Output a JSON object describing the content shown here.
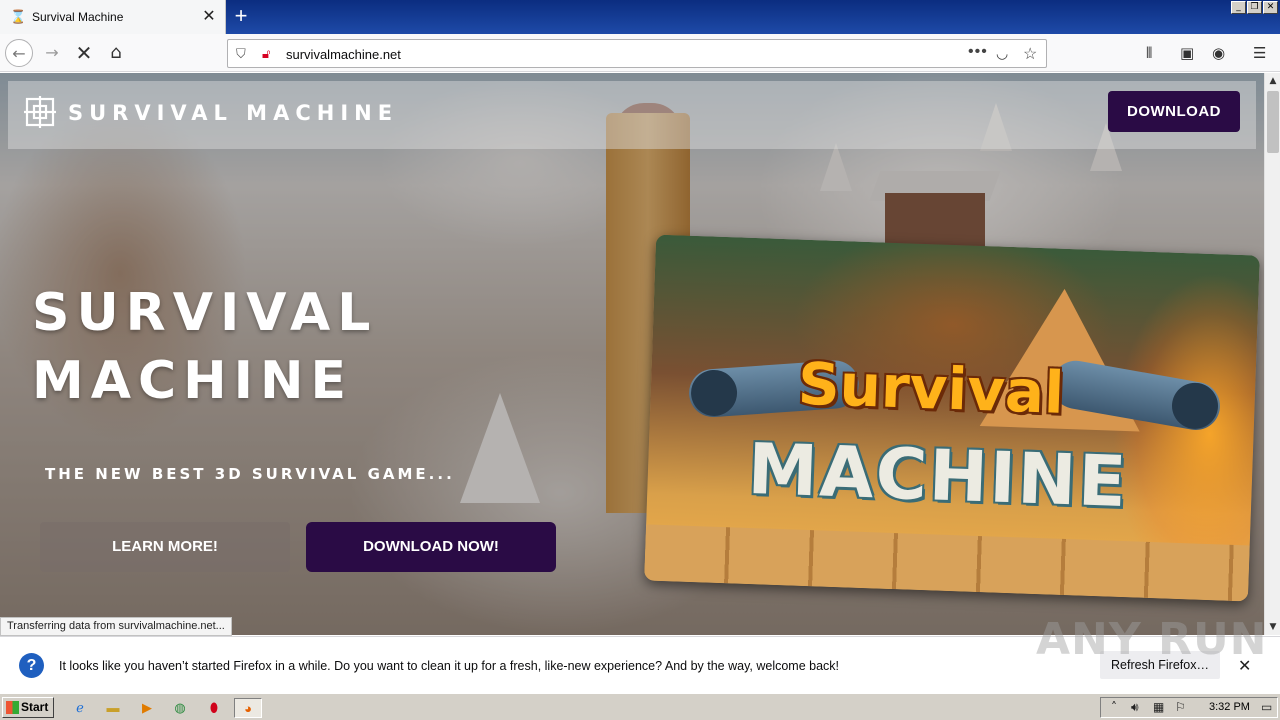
{
  "browser": {
    "tab_title": "Survival Machine",
    "tab_favicon": "hourglass-icon",
    "new_tab_label": "+",
    "url": "survivalmachine.net",
    "url_actions": "•••",
    "status_text": "Transferring data from survivalmachine.net..."
  },
  "site": {
    "brand": "SURVIVAL MACHINE",
    "nav_download": "DOWNLOAD",
    "hero_title_line1": "SURVIVAL",
    "hero_title_line2": "MACHINE",
    "hero_subtitle": "THE NEW BEST 3D SURVIVAL GAME...",
    "learn_more": "LEARN MORE!",
    "download_now": "DOWNLOAD NOW!",
    "card_title_line1": "Survival",
    "card_title_line2": "MACHINE",
    "brand_color": "#2a0b45"
  },
  "notification": {
    "message": "It looks like you haven’t started Firefox in a while. Do you want to clean it up for a fresh, like-new experience? And by the way, welcome back!",
    "refresh_button": "Refresh Firefox…",
    "close": "✕"
  },
  "watermark": "ANY RUN",
  "taskbar": {
    "start_label": "Start",
    "clock": "3:32 PM"
  }
}
